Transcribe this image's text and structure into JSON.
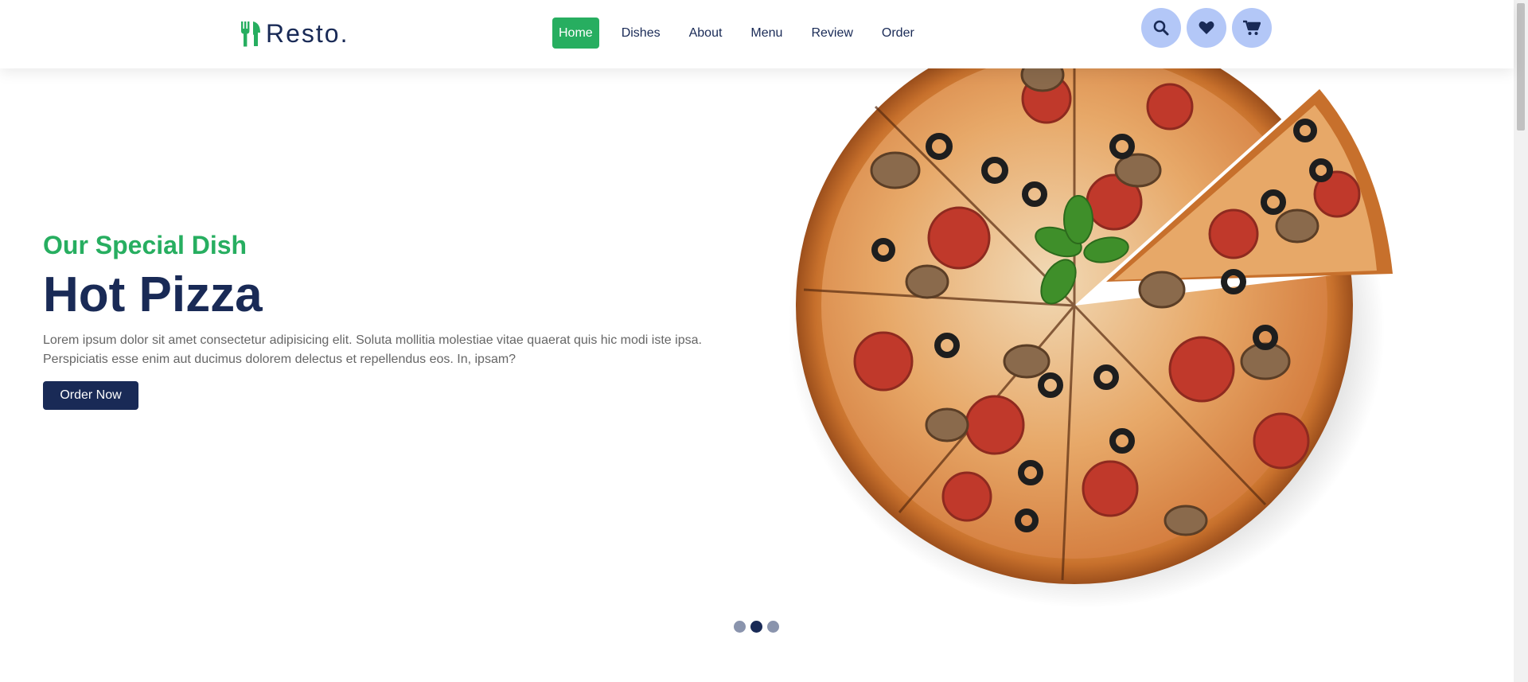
{
  "brand": {
    "name": "Resto.",
    "accent": "#27ae60",
    "primary": "#192a56"
  },
  "nav": {
    "items": [
      {
        "label": "Home",
        "active": true
      },
      {
        "label": "Dishes",
        "active": false
      },
      {
        "label": "About",
        "active": false
      },
      {
        "label": "Menu",
        "active": false
      },
      {
        "label": "Review",
        "active": false
      },
      {
        "label": "Order",
        "active": false
      }
    ]
  },
  "header_icons": [
    "search-icon",
    "heart-icon",
    "cart-icon"
  ],
  "hero": {
    "subtitle": "Our Special Dish",
    "title": "Hot Pizza",
    "description_line1": "Lorem ipsum dolor sit amet consectetur adipisicing elit. Soluta mollitia molestiae vitae quaerat quis hic modi iste ipsa.",
    "description_line2": "Perspiciatis esse enim aut ducimus dolorem delectus et repellendus eos. In, ipsam?",
    "cta": "Order Now"
  },
  "slider": {
    "count": 3,
    "active_index": 1
  }
}
